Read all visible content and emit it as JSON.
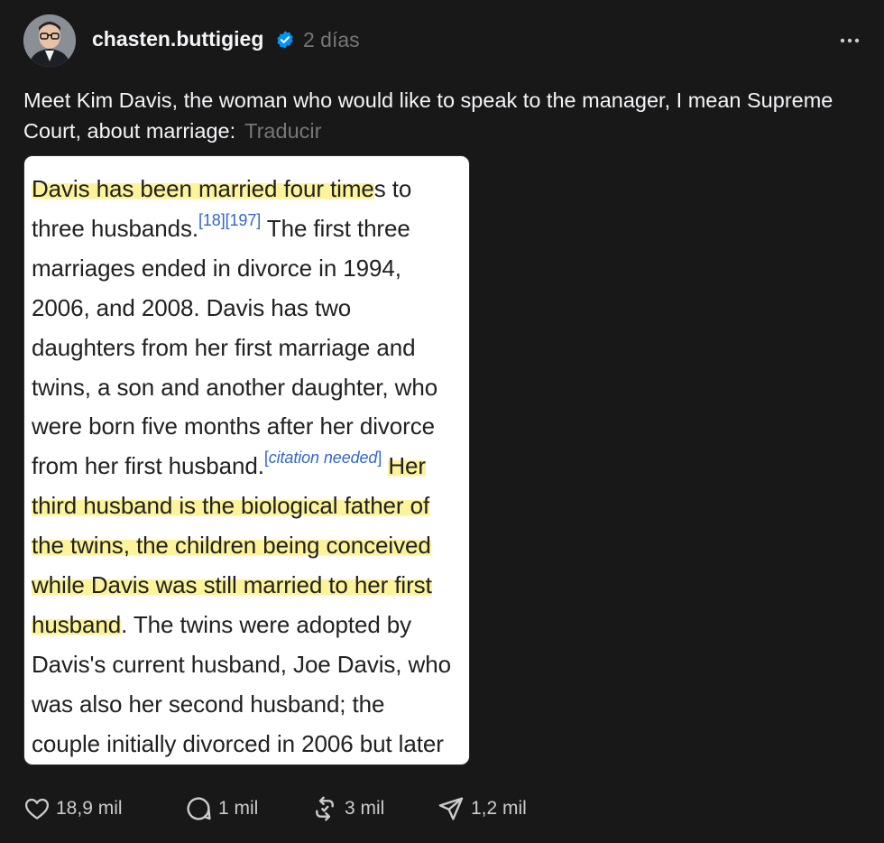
{
  "header": {
    "username": "chasten.buttigieg",
    "verified": true,
    "timestamp": "2 días"
  },
  "caption": {
    "text": "Meet Kim Davis, the woman who would like to speak to the manager, I mean Supreme Court, about marriage:",
    "translate_label": "Traducir"
  },
  "article": {
    "l1_hl": "Davis has been married four time",
    "l1_rest": "s to",
    "l2_pre": "three husbands.",
    "l2_ref": "[18][197]",
    "l2_post": " The first three",
    "l3": "marriages ended in divorce in 1994,",
    "l4": "2006, and 2008. Davis has two",
    "l5": "daughters from her first marriage and",
    "l6": "twins, a son and another daughter, who",
    "l7": "were born five months after her divorce",
    "l8_pre": "from her first husband.",
    "l8_cite_open": "[",
    "l8_cite": "citation needed",
    "l8_cite_close": "]",
    "l8_hl": "Her",
    "l9_hl": "third husband is the biological father of",
    "l10_hl": "the twins, the children being conceived",
    "l11_hl": "while Davis was still married to her first",
    "l12_hl": "husband",
    "l12_rest": ". The twins were adopted by",
    "l13": "Davis's current husband, Joe Davis, who",
    "l14": "was also her second husband; the",
    "l15": "couple initially divorced in 2006 but later"
  },
  "actions": {
    "likes": "18,9 mil",
    "replies": "1 mil",
    "reposts": "3 mil",
    "shares": "1,2 mil"
  },
  "colors": {
    "background": "#181818",
    "verified_badge": "#0095f6",
    "highlight": "#fdf39a",
    "link": "#3366cc",
    "muted": "#777777"
  },
  "icons": [
    "verified-badge-icon",
    "more-options-icon",
    "heart-icon",
    "comment-icon",
    "repost-icon",
    "share-icon"
  ]
}
